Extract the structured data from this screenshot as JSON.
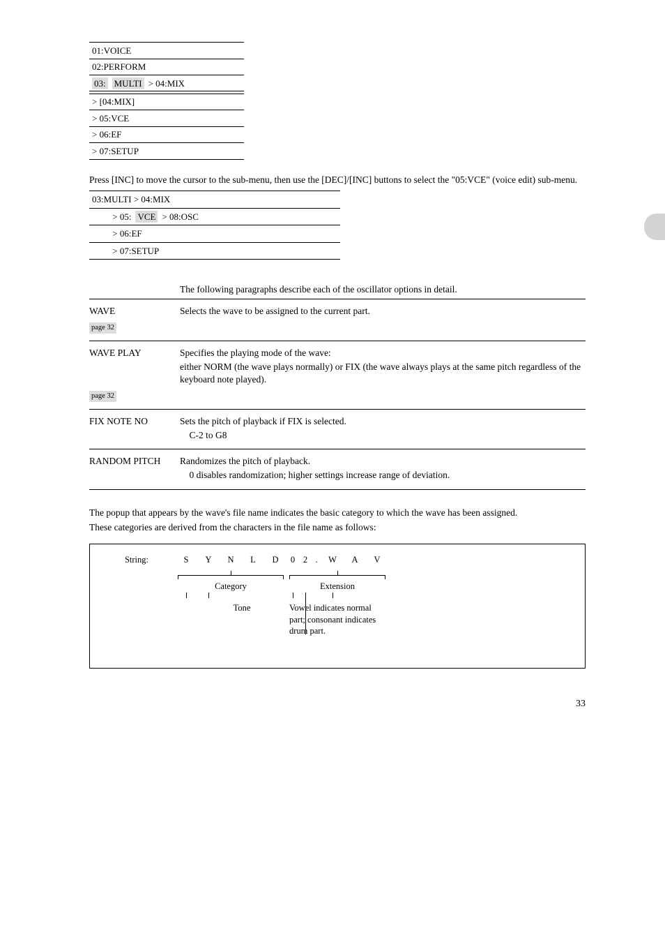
{
  "sideTab": "",
  "menu": {
    "r0": "01:VOICE",
    "r1": "02:PERFORM",
    "r2_pre": "03:",
    "r2_hl": "MULTI",
    "r2_post": ">  04:MIX",
    "r3": "> [04:MIX]",
    "r4": "> 05:VCE",
    "r5": "> 06:EF",
    "r6": "> 07:SETUP"
  },
  "sectionP": "Press [INC] to move the cursor to the sub-menu, then use the [DEC]/[INC] buttons to select the \"05:VCE\" (voice edit) sub-menu.",
  "submenu": {
    "s0": "03:MULTI > 04:MIX",
    "s1_pre": "         > 05:",
    "s1_hl": "VCE",
    "s1_post": "  > 08:OSC",
    "s2": "         > 06:EF",
    "s3": "         > 07:SETUP"
  },
  "optsHeader": {
    "c1": "",
    "c2": "The following paragraphs describe each of the oscillator options in detail."
  },
  "opts": [
    {
      "label": "WAVE",
      "desc": "Selects the wave to be assigned to the current part.",
      "extra": "",
      "tag": "page 32"
    },
    {
      "label": "WAVE PLAY",
      "desc": "Specifies the playing mode of the wave:",
      "extra": "either NORM (the wave plays normally) or FIX (the wave always plays at the same pitch regardless of the keyboard note played).",
      "tag": "page 32"
    },
    {
      "label": "FIX NOTE NO",
      "desc": "Sets the pitch of playback if FIX is selected.",
      "extra": "    C-2 to G8",
      "tag": ""
    },
    {
      "label": "RANDOM PITCH",
      "desc": "Randomizes the pitch of playback.",
      "extra": "    0 disables randomization; higher settings increase range of deviation.",
      "tag": ""
    }
  ],
  "deriv": {
    "intro1": "The popup that appears by the wave's file name indicates the basic category to which the wave has been assigned.",
    "intro2": "These categories are derived from the characters in the file name as follows:",
    "strLabel": "String:",
    "top": [
      "S",
      "Y",
      "N",
      "L",
      "D",
      "0",
      "2",
      ".",
      "W",
      "A",
      "V"
    ],
    "group1": "Category",
    "group2": "Extension",
    "cat1": "",
    "cat2": "Tone",
    "cat3": "",
    "ext_note": "",
    "vowel_note": "Vowel indicates normal part; consonant indicates drum part."
  },
  "pageNum": "33"
}
